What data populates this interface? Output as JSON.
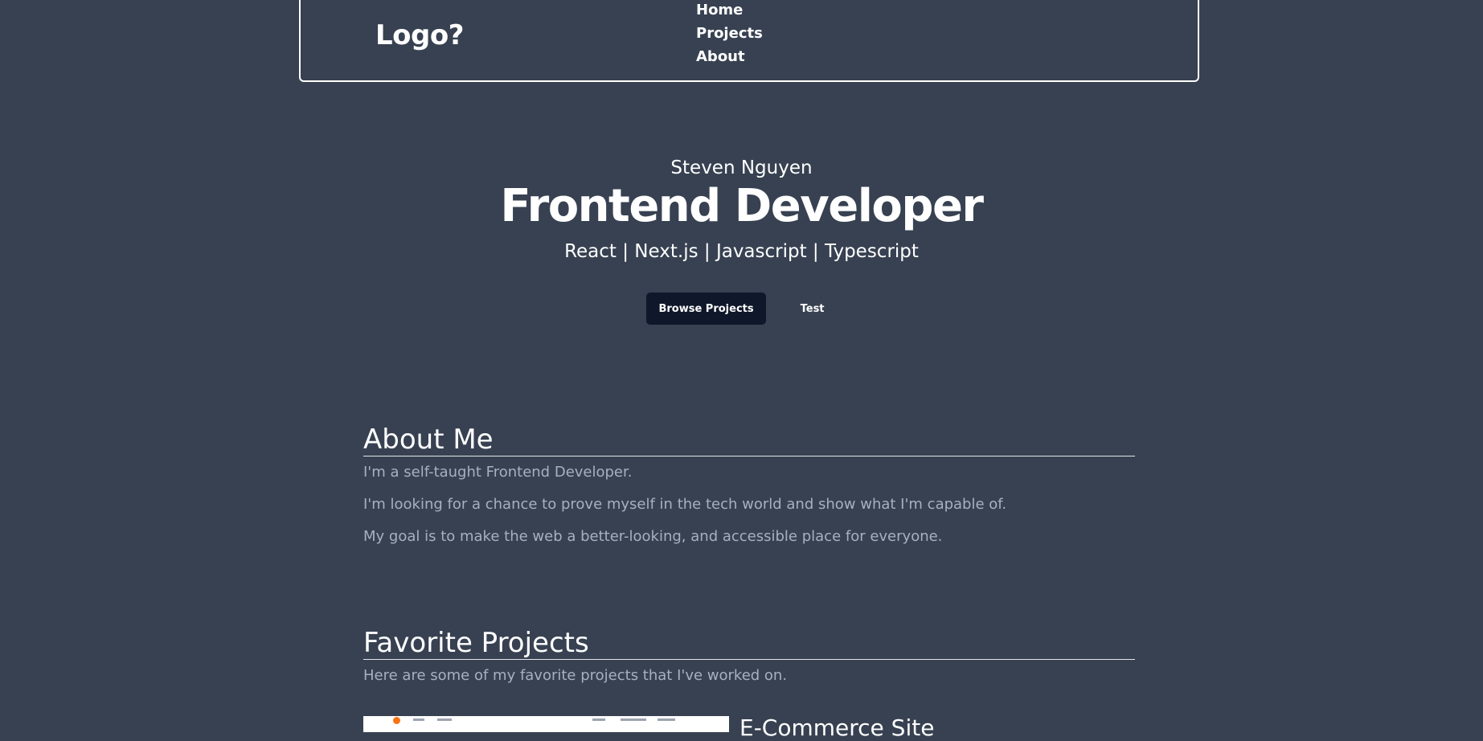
{
  "nav": {
    "logo": "Logo?",
    "links": [
      "Home",
      "Projects",
      "About"
    ]
  },
  "hero": {
    "name": "Steven Nguyen",
    "title": "Frontend Developer",
    "stack": "React | Next.js | Javascript | Typescript",
    "primary_button": "Browse Projects",
    "secondary_button": "Test"
  },
  "about": {
    "heading": "About Me",
    "paragraphs": [
      "I'm a self-taught Frontend Developer.",
      "I'm looking for a chance to prove myself in the tech world and show what I'm capable of.",
      "My goal is to make the web a better-looking, and accessible place for everyone."
    ]
  },
  "projects": {
    "heading": "Favorite Projects",
    "intro": "Here are some of my favorite projects that I've worked on.",
    "items": [
      {
        "title": "E-Commerce Site"
      }
    ]
  },
  "colors": {
    "background": "#374151",
    "text": "#ffffff",
    "muted_text": "#a7b0bf",
    "primary_button": "#0f172a"
  }
}
